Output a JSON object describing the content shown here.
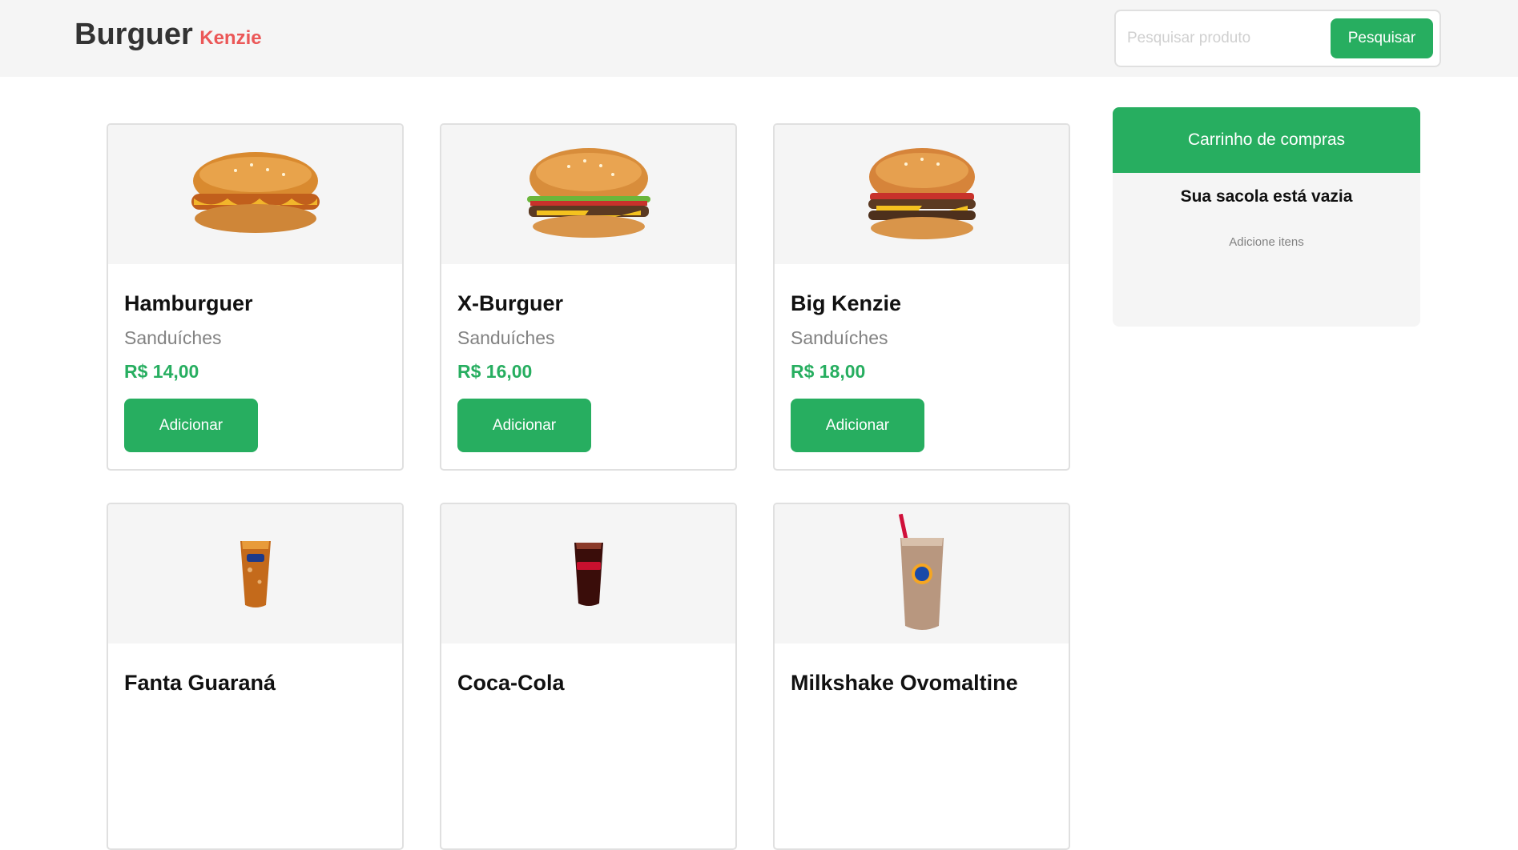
{
  "header": {
    "logo_main": "Burguer",
    "logo_accent": "Kenzie",
    "search_placeholder": "Pesquisar produto",
    "search_button": "Pesquisar"
  },
  "products": [
    {
      "name": "Hamburguer",
      "category": "Sanduíches",
      "price": "R$ 14,00",
      "button": "Adicionar",
      "icon": "burger-icon"
    },
    {
      "name": "X-Burguer",
      "category": "Sanduíches",
      "price": "R$ 16,00",
      "button": "Adicionar",
      "icon": "cheeseburger-icon"
    },
    {
      "name": "Big Kenzie",
      "category": "Sanduíches",
      "price": "R$ 18,00",
      "button": "Adicionar",
      "icon": "double-burger-icon"
    },
    {
      "name": "Fanta Guaraná",
      "category": "",
      "price": "",
      "button": "",
      "icon": "soda-glass-icon"
    },
    {
      "name": "Coca-Cola",
      "category": "",
      "price": "",
      "button": "",
      "icon": "cola-glass-icon"
    },
    {
      "name": "Milkshake Ovomaltine",
      "category": "",
      "price": "",
      "button": "",
      "icon": "milkshake-icon"
    }
  ],
  "cart": {
    "title": "Carrinho de compras",
    "empty_message": "Sua sacola está vazia",
    "hint": "Adicione itens"
  },
  "colors": {
    "primary": "#27ae60",
    "accent": "#eb5757",
    "grey_bg": "#f5f5f5",
    "text_grey": "#828282"
  }
}
